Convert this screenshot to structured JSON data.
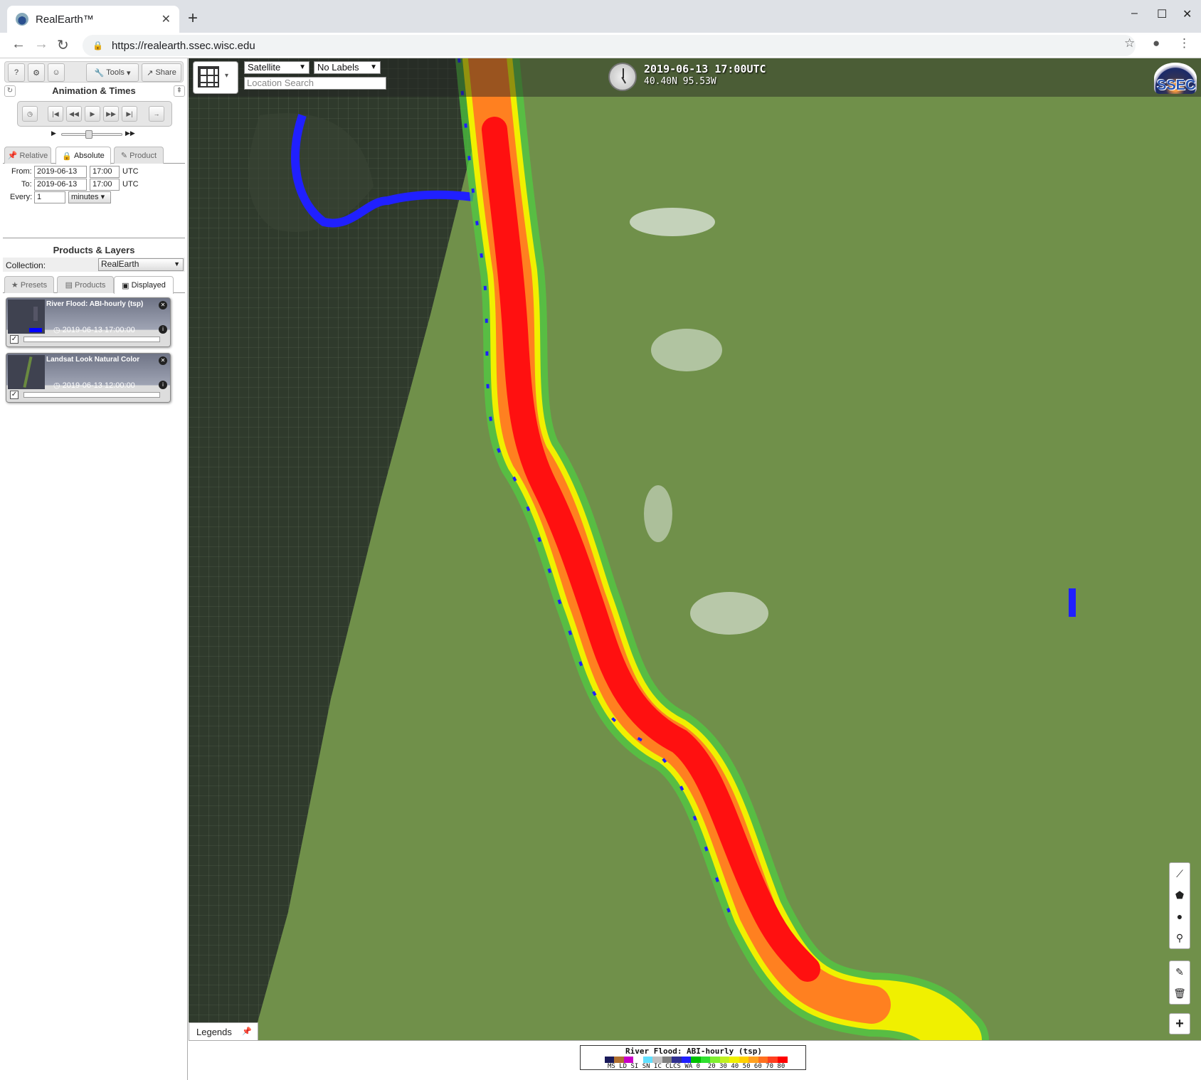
{
  "browser": {
    "tab_title": "RealEarth™",
    "url": "https://realearth.ssec.wisc.edu"
  },
  "panel": {
    "top_buttons": {
      "help": "?",
      "settings": "⚙",
      "user": "☺",
      "tools": "Tools",
      "share": "Share"
    },
    "animation_title": "Animation & Times",
    "time_tabs": [
      "Relative",
      "Absolute",
      "Product"
    ],
    "from_label": "From:",
    "to_label": "To:",
    "every_label": "Every:",
    "from_date": "2019-06-13",
    "from_time": "17:00",
    "to_date": "2019-06-13",
    "to_time": "17:00",
    "tz": "UTC",
    "every_value": "1",
    "every_unit": "minutes",
    "products_title": "Products & Layers",
    "collection_label": "Collection:",
    "collection_value": "RealEarth",
    "layer_tabs": [
      "Presets",
      "Products",
      "Displayed"
    ],
    "layers": [
      {
        "title": "River Flood: ABI-hourly (tsp)",
        "time": "2019-06-13 17:00:00"
      },
      {
        "title": "Landsat Look Natural Color",
        "time": "2019-06-13 12:00:00"
      }
    ]
  },
  "map": {
    "basemap": "Satellite",
    "labels": "No Labels",
    "search_placeholder": "Location Search",
    "datetime": "2019-06-13 17:00UTC",
    "coords": "40.40N 95.53W",
    "logo_text": "SSEC",
    "legends_tab": "Legends"
  },
  "legend": {
    "title": "River Flood: ABI-hourly (tsp)",
    "labels": "MS LD SI SN IC CLCS WA 0  20 30 40 50 60 70 80",
    "colors": [
      "#1a1a5a",
      "#b07030",
      "#c800c8",
      "#ffffff",
      "#60e0ff",
      "#c0c0c0",
      "#808080",
      "#303090",
      "#2020ff",
      "#00c000",
      "#30e030",
      "#80f030",
      "#c0f020",
      "#f0f000",
      "#ffd000",
      "#ffa020",
      "#ff7020",
      "#ff4020",
      "#ff0000"
    ]
  }
}
